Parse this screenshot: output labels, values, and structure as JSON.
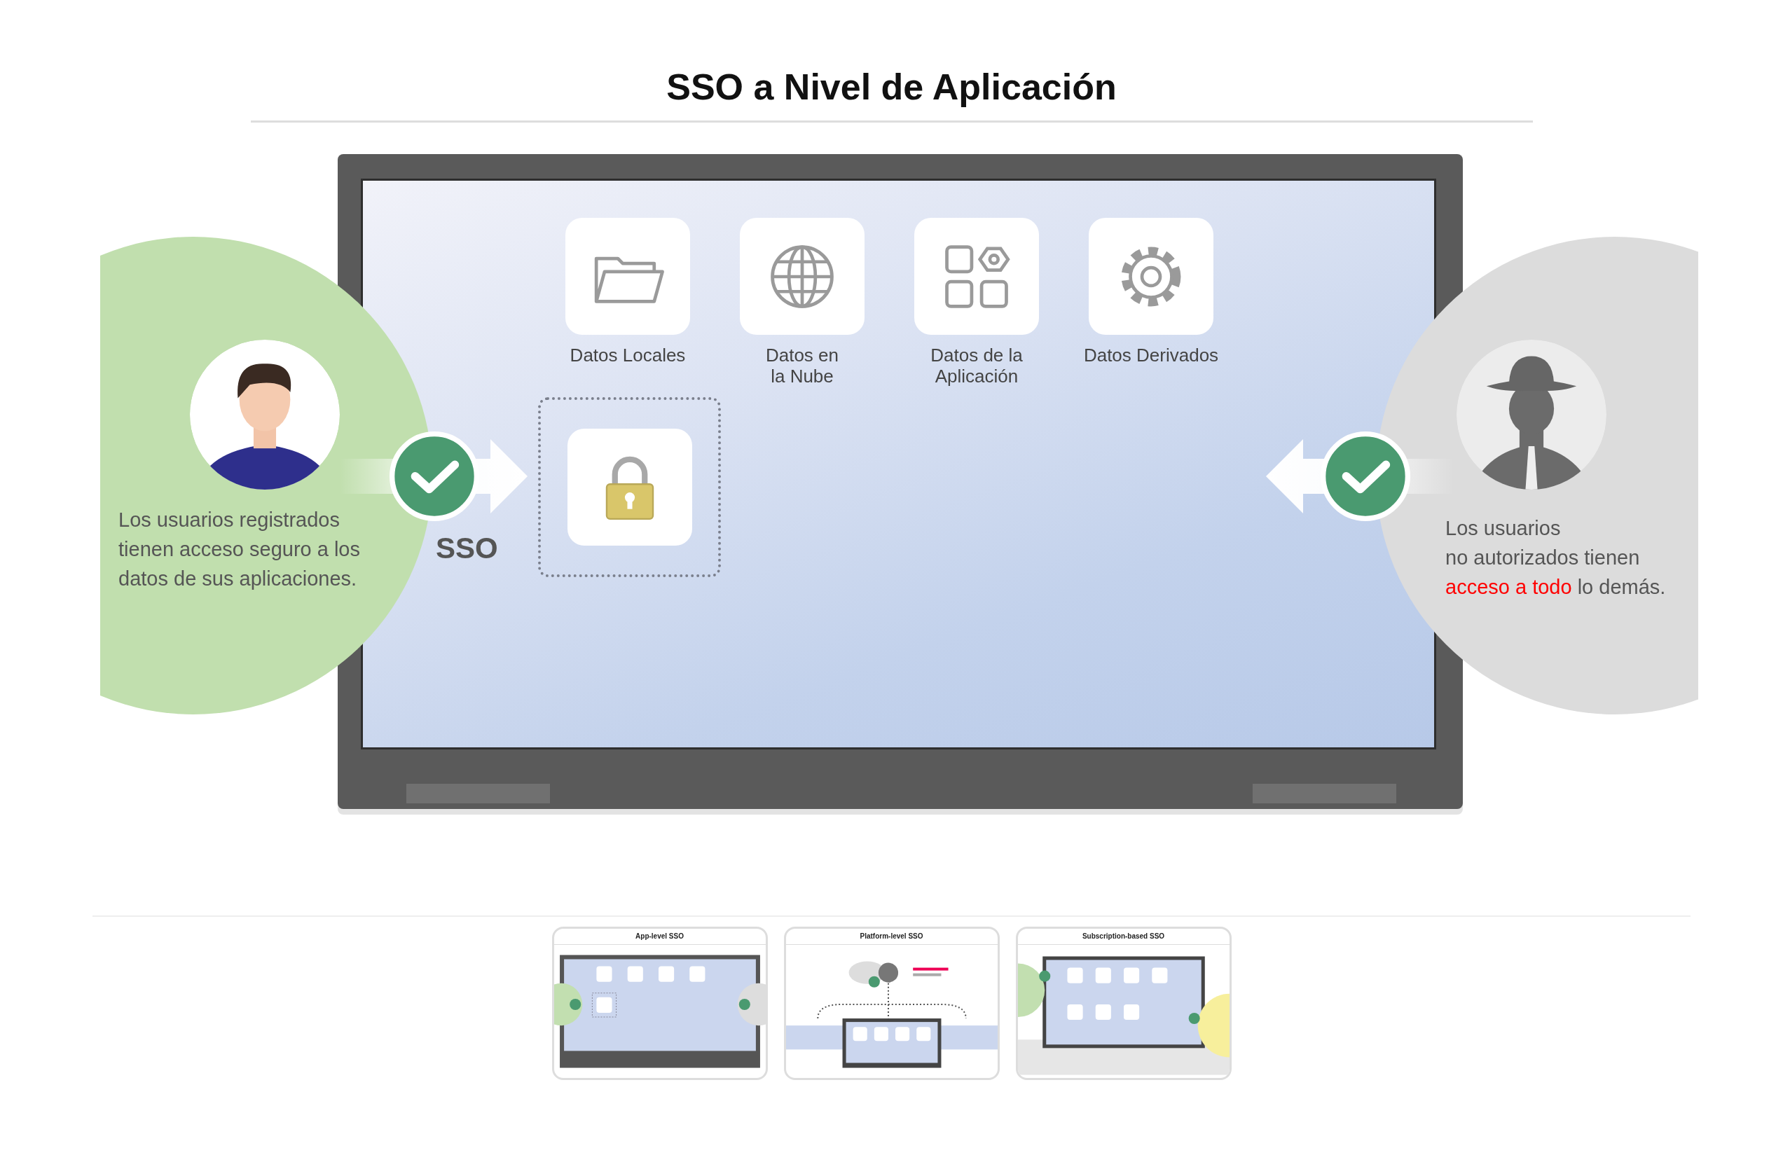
{
  "title": "SSO a Nivel de Aplicación",
  "apps": [
    {
      "label": "Datos Locales",
      "kind": "folder"
    },
    {
      "label": "Datos en\nla Nube",
      "kind": "globe"
    },
    {
      "label": "Datos de la\nAplicación",
      "kind": "apps"
    },
    {
      "label": "Datos Derivados",
      "kind": "gear"
    }
  ],
  "sso_label": "SSO",
  "registered_note": "Los usuarios registrados\ntienen acceso seguro a los\ndatos de sus aplicaciones.",
  "unauthorized_note": "Los usuarios\nno autorizados tienen\n**acceso a todo** lo demás.",
  "thumbnails": [
    {
      "title": "App-level SSO",
      "kind": "app"
    },
    {
      "title": "Platform-level SSO",
      "kind": "platform"
    },
    {
      "title": "Subscription-based SSO",
      "kind": "subscription"
    }
  ]
}
